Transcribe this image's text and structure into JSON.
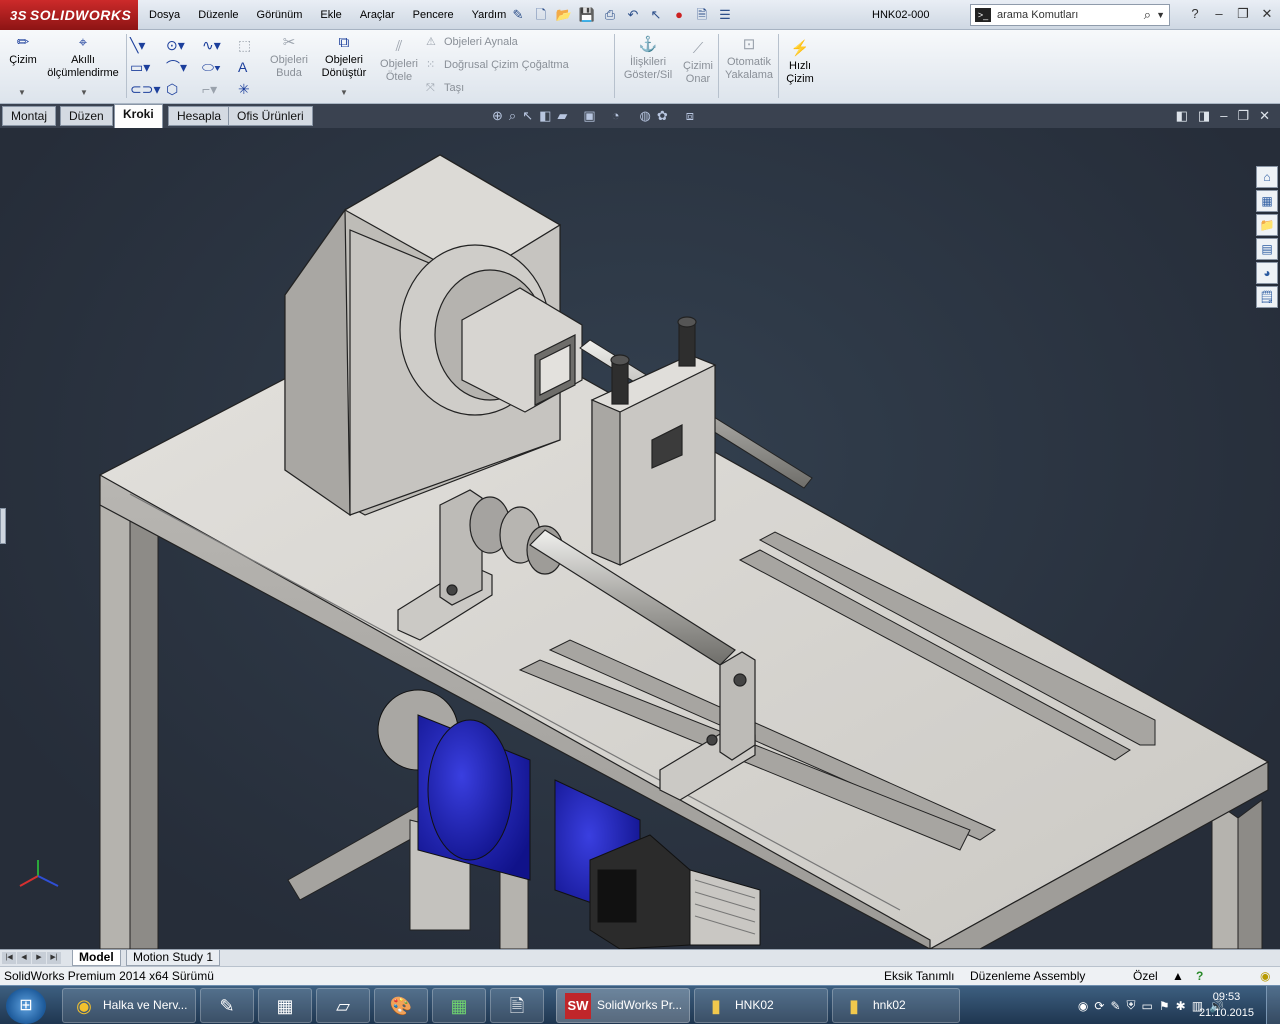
{
  "app": {
    "logo_prefix": "3S",
    "logo_text": "SOLIDWORKS",
    "document_title": "HNK02-000"
  },
  "menu": [
    "Dosya",
    "Düzenle",
    "Görünüm",
    "Ekle",
    "Araçlar",
    "Pencere",
    "Yardım"
  ],
  "search": {
    "placeholder": "arama Komutları"
  },
  "ribbon": {
    "cizim": "Çizim",
    "akilli_l1": "Akıllı",
    "akilli_l2": "ölçümlendirme",
    "buda_l1": "Objeleri",
    "buda_l2": "Buda",
    "donustur_l1": "Objeleri",
    "donustur_l2": "Dönüştür",
    "otele_l1": "Objeleri",
    "otele_l2": "Ötele",
    "aynala": "Objeleri Aynala",
    "cogaltma": "Doğrusal Çizim Çoğaltma",
    "tasi": "Taşı",
    "iliski_l1": "İlişkileri",
    "iliski_l2": "Göster/Sil",
    "onar_l1": "Çizimi",
    "onar_l2": "Onar",
    "yakalama_l1": "Otomatik",
    "yakalama_l2": "Yakalama",
    "hizli_l1": "Hızlı",
    "hizli_l2": "Çizim"
  },
  "command_tabs": [
    "Montaj",
    "Düzen",
    "Kroki",
    "Hesapla",
    "Ofis Ürünleri"
  ],
  "active_command_tab": "Kroki",
  "model_tabs": [
    "Model",
    "Motion Study 1"
  ],
  "status": {
    "version": "SolidWorks Premium 2014 x64 Sürümü",
    "definition": "Eksik Tanımlı",
    "mode": "Düzenleme Assembly",
    "custom": "Özel"
  },
  "taskbar": {
    "items": [
      {
        "label": "Halka ve Nerv...",
        "icon": "chrome-icon"
      },
      {
        "label": "",
        "icon": "sketch-app-icon"
      },
      {
        "label": "",
        "icon": "calculator-icon"
      },
      {
        "label": "",
        "icon": "notes-icon"
      },
      {
        "label": "",
        "icon": "paint-icon"
      },
      {
        "label": "",
        "icon": "excel-icon"
      },
      {
        "label": "",
        "icon": "explorer-docs-icon"
      },
      {
        "label": "SolidWorks Pr...",
        "icon": "solidworks-icon"
      },
      {
        "label": "HNK02",
        "icon": "folder-icon"
      },
      {
        "label": "hnk02",
        "icon": "folder-icon"
      }
    ],
    "time": "09:53",
    "date": "21.10.2015"
  },
  "colors": {
    "brand": "#c0262a",
    "viewport_bg": "#2a3140",
    "motor_blue": "#1e22b8",
    "part_gray": "#d8d6d2"
  }
}
